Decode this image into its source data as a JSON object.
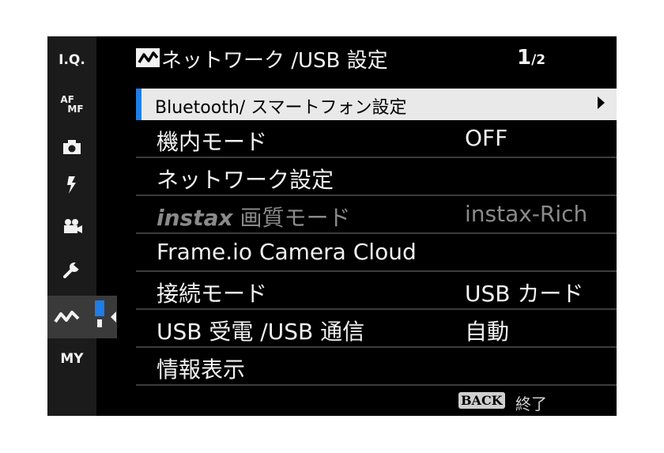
{
  "sidebar": {
    "items": [
      {
        "label": "I.Q."
      },
      {
        "label_top": "AF",
        "label_bottom": "MF"
      },
      {
        "icon": "camera-icon"
      },
      {
        "icon": "flash-icon"
      },
      {
        "icon": "movie-camera-icon"
      },
      {
        "icon": "wrench-icon"
      },
      {
        "icon": "network-icon"
      },
      {
        "label": "MY"
      }
    ],
    "active_index": 6,
    "accent_color": "#1e7de6"
  },
  "header": {
    "icon": "network-icon",
    "title": "ネットワーク /USB 設定",
    "page_current": "1",
    "page_total": "/2"
  },
  "menu": {
    "rows": [
      {
        "label": "Bluetooth/ スマートフォン設定",
        "value": "",
        "selected": true,
        "has_submenu": true
      },
      {
        "label": "機内モード",
        "value": "OFF"
      },
      {
        "label": "ネットワーク設定",
        "value": ""
      },
      {
        "label_prefix": "instax",
        "label": " 画質モード",
        "value": "instax-Rich",
        "disabled": true
      },
      {
        "label": "Frame.io Camera Cloud",
        "value": ""
      },
      {
        "label": "接続モード",
        "value": "USB カード"
      },
      {
        "label": "USB 受電 /USB 通信",
        "value": "自動"
      },
      {
        "label": "情報表示",
        "value": ""
      }
    ]
  },
  "footer": {
    "back_badge": "BACK",
    "back_text": "終了"
  }
}
